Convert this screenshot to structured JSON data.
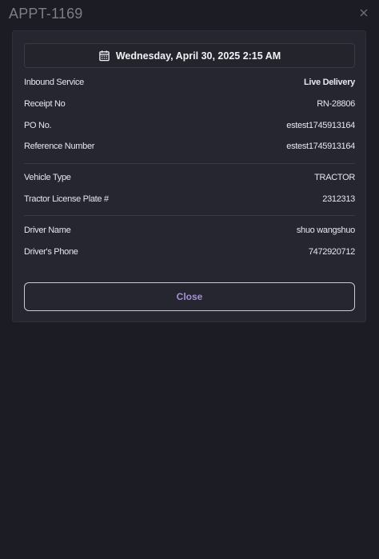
{
  "header": {
    "title": "APPT-1169"
  },
  "appointment": {
    "datetime": "Wednesday, April 30, 2025 2:15 AM",
    "details": [
      {
        "label": "Inbound Service",
        "value": "Live Delivery"
      },
      {
        "label": "Receipt No",
        "value": "RN-28806"
      },
      {
        "label": "PO No.",
        "value": "estest1745913164"
      },
      {
        "label": "Reference Number",
        "value": "estest1745913164"
      }
    ],
    "vehicle": [
      {
        "label": "Vehicle Type",
        "value": "TRACTOR"
      },
      {
        "label": "Tractor License Plate #",
        "value": "2312313"
      }
    ],
    "driver": [
      {
        "label": "Driver Name",
        "value": "shuo wangshuo"
      },
      {
        "label": "Driver's Phone",
        "value": "7472920712"
      }
    ]
  },
  "actions": {
    "close_label": "Close"
  },
  "icons": {
    "close": "close-icon",
    "calendar": "calendar-icon"
  },
  "colors": {
    "background": "#1c1c24",
    "card": "#262630",
    "accent": "#a98fd6",
    "muted_title": "#7c7d86"
  }
}
